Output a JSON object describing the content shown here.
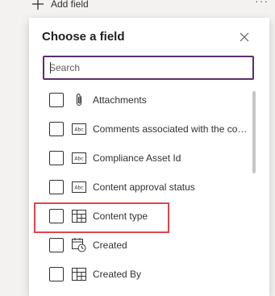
{
  "topbar": {
    "add_field_label": "Add field",
    "more_label": "···"
  },
  "panel": {
    "title": "Choose a field",
    "search_placeholder": "Search"
  },
  "fields": [
    {
      "label": "Attachments",
      "icon": "paperclip-icon"
    },
    {
      "label": "Comments associated with the content approval of this list item",
      "icon": "text-field-icon"
    },
    {
      "label": "Compliance Asset Id",
      "icon": "text-field-icon"
    },
    {
      "label": "Content approval status",
      "icon": "text-field-icon"
    },
    {
      "label": "Content type",
      "icon": "content-type-icon"
    },
    {
      "label": "Created",
      "icon": "calendar-clock-icon"
    },
    {
      "label": "Created By",
      "icon": "content-type-icon"
    }
  ],
  "colors": {
    "search_border": "#5b2e6e",
    "highlight": "#e0454f"
  }
}
